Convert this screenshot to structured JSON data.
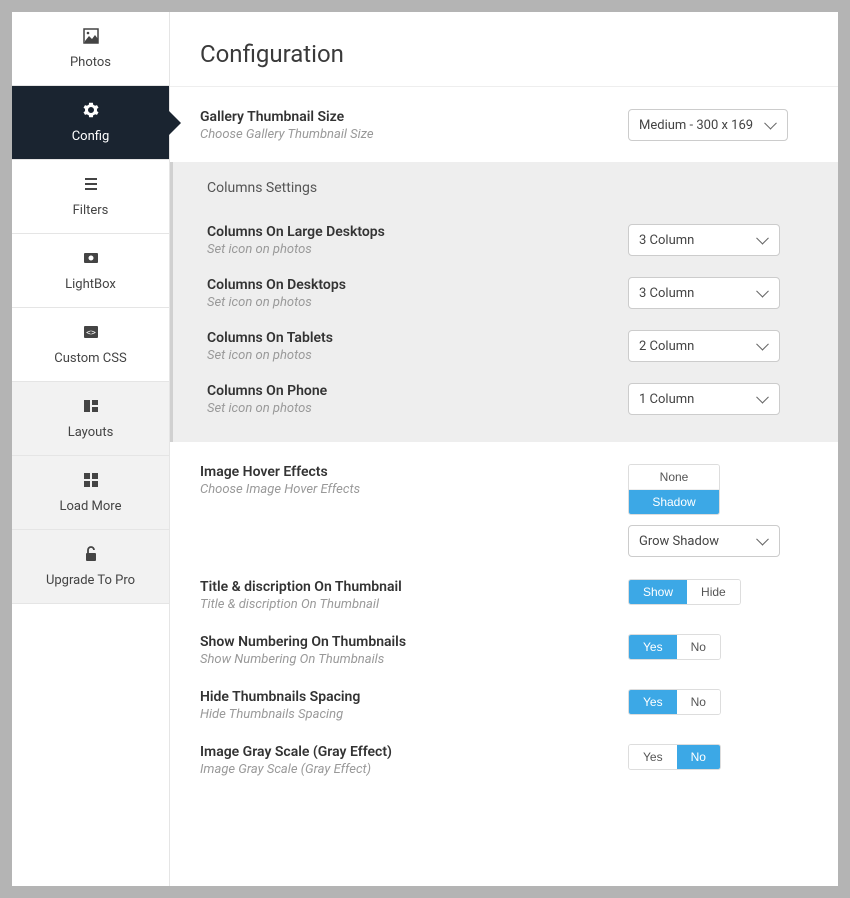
{
  "sidebar": {
    "items": [
      {
        "label": "Photos"
      },
      {
        "label": "Config"
      },
      {
        "label": "Filters"
      },
      {
        "label": "LightBox"
      },
      {
        "label": "Custom CSS"
      },
      {
        "label": "Layouts"
      },
      {
        "label": "Load More"
      },
      {
        "label": "Upgrade To Pro"
      }
    ]
  },
  "header": {
    "title": "Configuration"
  },
  "settings": {
    "thumbnail": {
      "label": "Gallery Thumbnail Size",
      "desc": "Choose Gallery Thumbnail Size",
      "value": "Medium - 300 x 169"
    },
    "columnsPanel": {
      "title": "Columns Settings"
    },
    "colLarge": {
      "label": "Columns On Large Desktops",
      "desc": "Set icon on photos",
      "value": "3 Column"
    },
    "colDesktop": {
      "label": "Columns On Desktops",
      "desc": "Set icon on photos",
      "value": "3 Column"
    },
    "colTablet": {
      "label": "Columns On Tablets",
      "desc": "Set icon on photos",
      "value": "2 Column"
    },
    "colPhone": {
      "label": "Columns On Phone",
      "desc": "Set icon on photos",
      "value": "1 Column"
    },
    "hover": {
      "label": "Image Hover Effects",
      "desc": "Choose Image Hover Effects",
      "opt_none": "None",
      "opt_shadow": "Shadow",
      "value": "Grow Shadow"
    },
    "titleDesc": {
      "label": "Title & discription On Thumbnail",
      "desc": "Title & discription On Thumbnail",
      "opt_a": "Show",
      "opt_b": "Hide"
    },
    "numbering": {
      "label": "Show Numbering On Thumbnails",
      "desc": "Show Numbering On Thumbnails",
      "opt_a": "Yes",
      "opt_b": "No"
    },
    "spacing": {
      "label": "Hide Thumbnails Spacing",
      "desc": "Hide Thumbnails Spacing",
      "opt_a": "Yes",
      "opt_b": "No"
    },
    "gray": {
      "label": "Image Gray Scale (Gray Effect)",
      "desc": "Image Gray Scale (Gray Effect)",
      "opt_a": "Yes",
      "opt_b": "No"
    }
  }
}
